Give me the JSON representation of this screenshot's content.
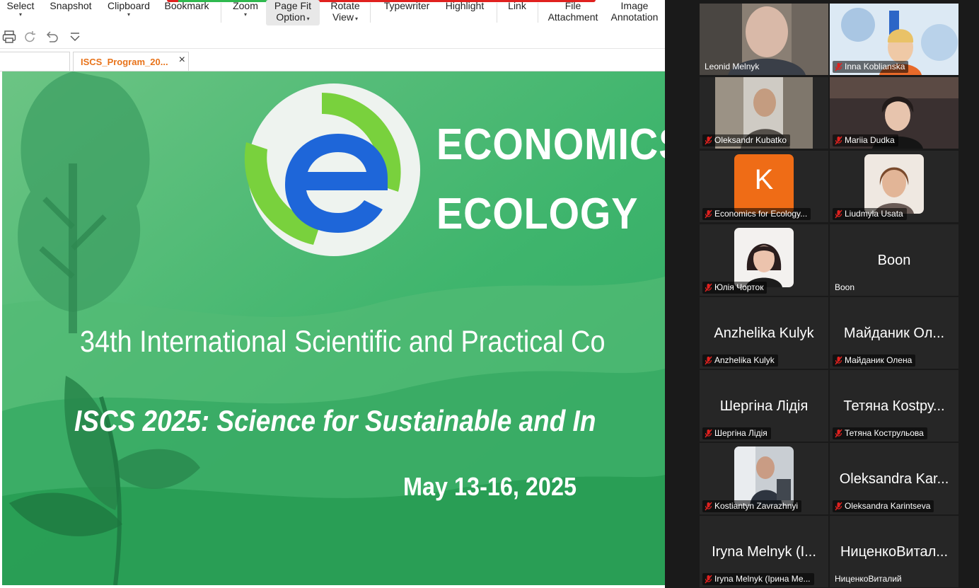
{
  "toolbar": {
    "select": "Select",
    "snapshot": "Snapshot",
    "clipboard": "Clipboard",
    "bookmark": "Bookmark",
    "zoom": "Zoom",
    "page_fit": [
      "Page Fit",
      "Option"
    ],
    "rotate_view": [
      "Rotate",
      "View"
    ],
    "typewriter": "Typewriter",
    "highlight": "Highlight",
    "link": "Link",
    "file_attachment": [
      "File",
      "Attachment"
    ],
    "image_annotation": [
      "Image",
      "Annotation"
    ]
  },
  "tabs": {
    "active_title": "ISCS_Program_20...",
    "close": "×"
  },
  "document": {
    "logo_title": [
      "ECONOMICS",
      "ECOLOGY"
    ],
    "conference": "34th International Scientific and Practical Co",
    "subtitle": "ISCS 2025: Science for Sustainable and In",
    "dates": "May 13-16, 2025"
  },
  "participants": [
    {
      "name": "Leonid Melnyk",
      "muted": false,
      "active": true,
      "kind": "video"
    },
    {
      "name": "Inna Koblianska",
      "muted": true,
      "kind": "video"
    },
    {
      "name": "Oleksandr Kubatko",
      "muted": true,
      "kind": "video"
    },
    {
      "name": "Mariia Dudka",
      "muted": true,
      "kind": "video"
    },
    {
      "name": "Economics for Ecology...",
      "muted": true,
      "kind": "letter",
      "letter": "K"
    },
    {
      "name": "Liudmyla Usata",
      "muted": true,
      "kind": "photo"
    },
    {
      "name": "Юлія Чорток",
      "muted": true,
      "kind": "photo"
    },
    {
      "name": "Boon",
      "display": "Boon",
      "muted": false,
      "kind": "name"
    },
    {
      "name": "Anzhelika Kulyk",
      "display": "Anzhelika Kulyk",
      "muted": true,
      "kind": "name"
    },
    {
      "name": "Майданик Олена",
      "display": "Майданик Ол...",
      "muted": true,
      "kind": "name"
    },
    {
      "name": "Шергіна Лідія",
      "display": "Шергіна Лідія",
      "muted": true,
      "kind": "name"
    },
    {
      "name": "Тетяна Кострульова",
      "display": "Тетяна Кostру...",
      "muted": true,
      "kind": "name"
    },
    {
      "name": "Kostiantyn Zavrazhnyi",
      "muted": true,
      "kind": "photo"
    },
    {
      "name": "Oleksandra Karintseva",
      "display": "Oleksandra Kar...",
      "muted": true,
      "kind": "name"
    },
    {
      "name": "Iryna Melnyk (Ірина Ме...",
      "display": "Iryna Melnyk (I...",
      "muted": true,
      "kind": "name"
    },
    {
      "name": "НиценкоВиталий",
      "display": "НиценкоВитал...",
      "muted": false,
      "kind": "name"
    }
  ],
  "colors": {
    "gallery_bg": "#1a1a1a",
    "tile_bg": "#262626",
    "active_speaker": "#4fd14f",
    "mute_red": "#e0211f",
    "tab_orange": "#e8731a",
    "slide_green": "#3cb36a"
  }
}
